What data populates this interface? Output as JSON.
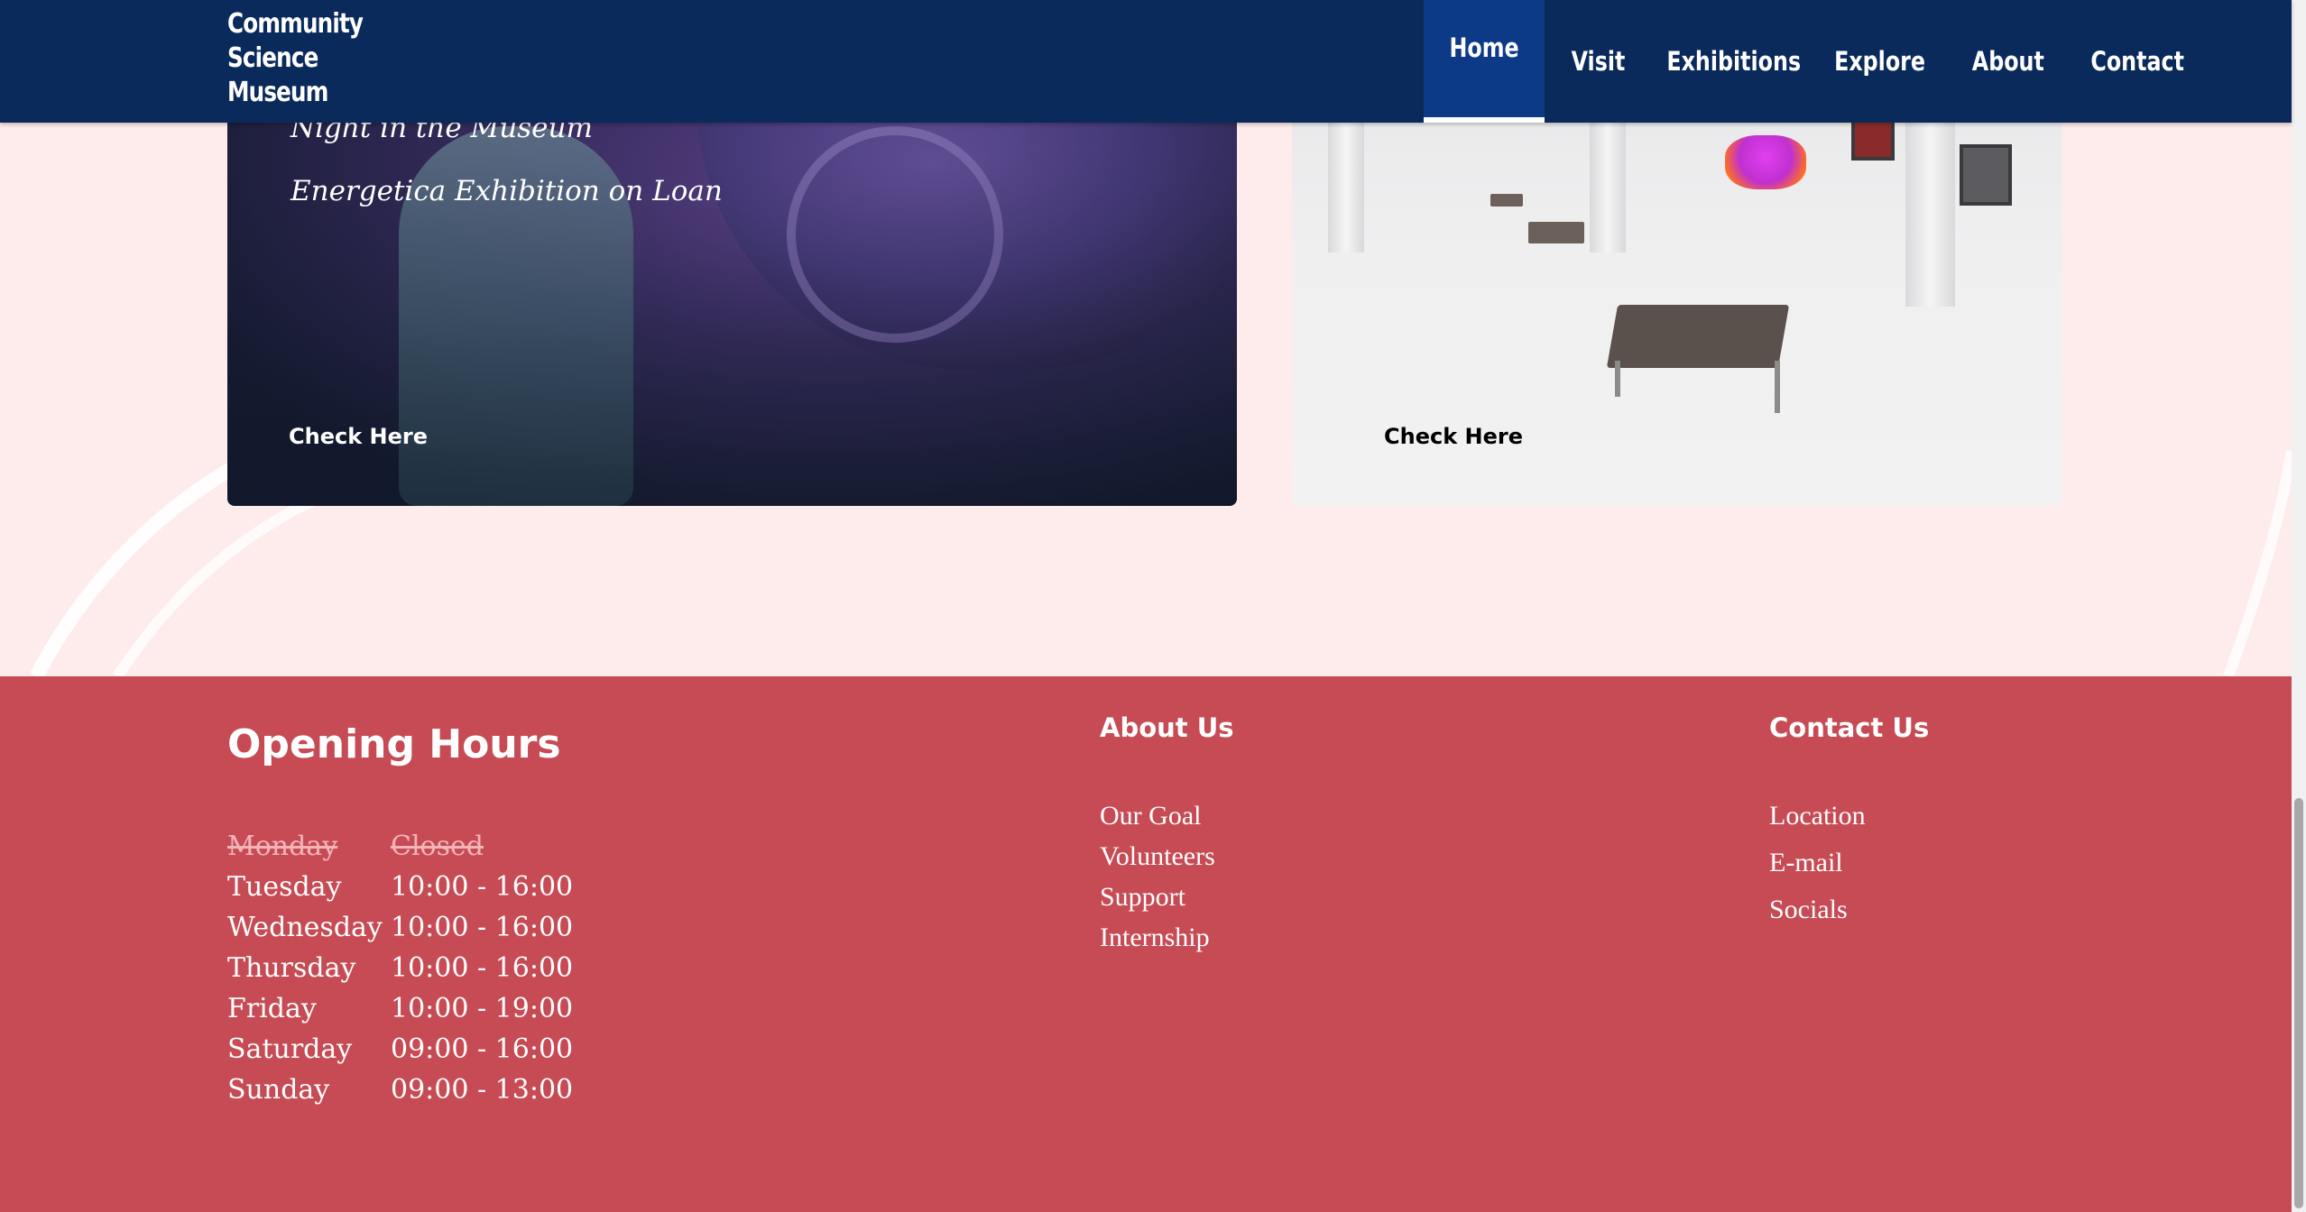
{
  "header": {
    "logo_lines": [
      "Community",
      "Science",
      "Museum"
    ],
    "nav": [
      {
        "label": "Home",
        "active": true
      },
      {
        "label": "Visit",
        "active": false
      },
      {
        "label": "Exhibitions",
        "active": false
      },
      {
        "label": "Explore",
        "active": false
      },
      {
        "label": "About",
        "active": false
      },
      {
        "label": "Contact",
        "active": false
      }
    ]
  },
  "cards": {
    "left": {
      "lines": [
        "Night in the Museum",
        "Energetica Exhibition on Loan"
      ],
      "cta": "Check Here"
    },
    "right": {
      "cta": "Check Here"
    }
  },
  "footer": {
    "hours": {
      "title": "Opening Hours",
      "rows": [
        {
          "day": "Monday",
          "time": "Closed",
          "closed": true
        },
        {
          "day": "Tuesday",
          "time": "10:00 - 16:00",
          "closed": false
        },
        {
          "day": "Wednesday",
          "time": "10:00 - 16:00",
          "closed": false
        },
        {
          "day": "Thursday",
          "time": "10:00 - 16:00",
          "closed": false
        },
        {
          "day": "Friday",
          "time": "10:00 - 19:00",
          "closed": false
        },
        {
          "day": "Saturday",
          "time": "09:00 - 16:00",
          "closed": false
        },
        {
          "day": "Sunday",
          "time": "09:00 - 13:00",
          "closed": false
        }
      ]
    },
    "about": {
      "title": "About Us",
      "links": [
        "Our Goal",
        "Volunteers",
        "Support",
        "Internship"
      ]
    },
    "contact": {
      "title": "Contact Us",
      "links": [
        "Location",
        "E-mail",
        "Socials"
      ]
    }
  },
  "colors": {
    "nav_bg": "#0a2a5c",
    "nav_active": "#0c3a86",
    "page_bg": "#feecec",
    "footer_bg": "#c74b54"
  }
}
